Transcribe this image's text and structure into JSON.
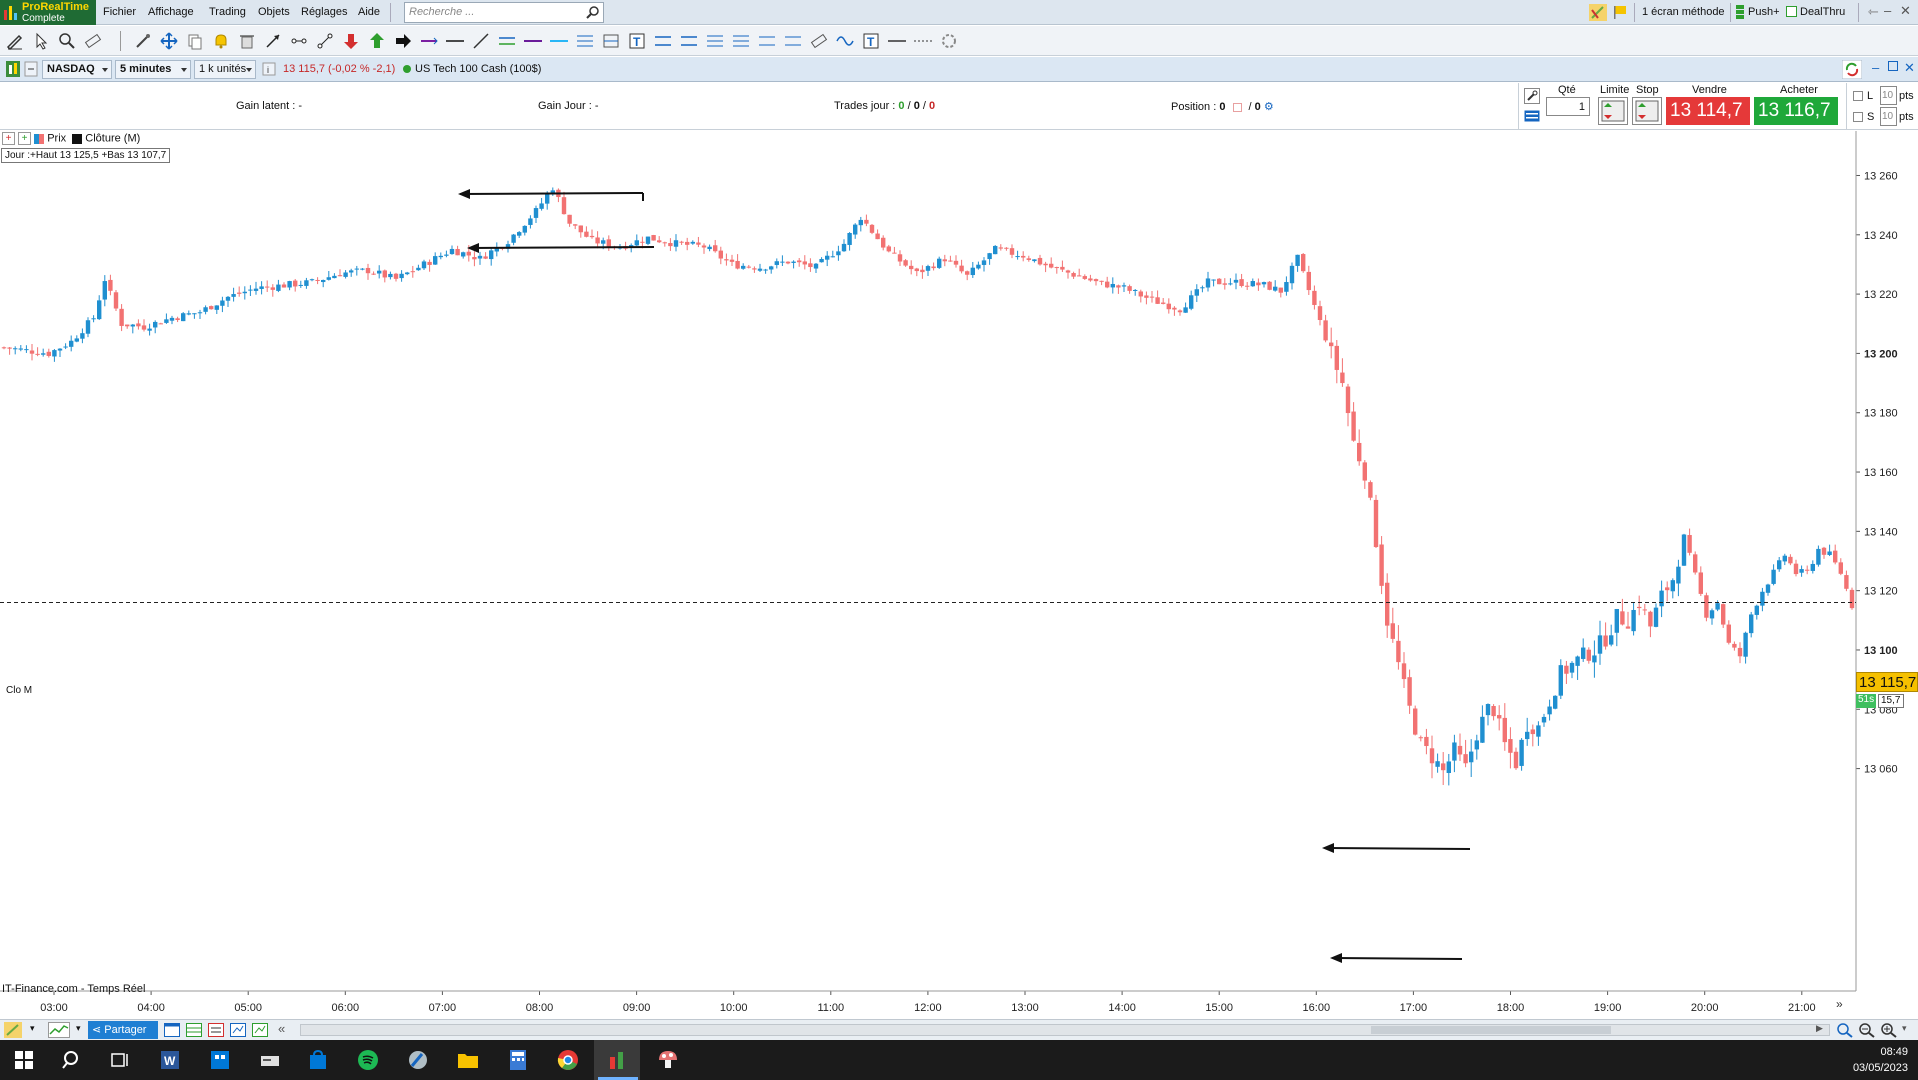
{
  "app": {
    "brand_line1": "ProRealTime",
    "brand_line2": "Complete"
  },
  "menu": {
    "items": [
      "Fichier",
      "Affichage",
      "Trading",
      "Objets",
      "Réglages",
      "Aide"
    ],
    "search_placeholder": "Recherche ...",
    "layout_label": "1 écran méthode",
    "push_label": "Push+",
    "dealthru_label": "DealThru"
  },
  "instrument": {
    "market": "NASDAQ",
    "timeframe": "5 minutes",
    "units": "1 k unités",
    "quote": "13 115,7 (-0,02 % -2,1)",
    "name": "US Tech 100 Cash (100$)"
  },
  "trading": {
    "gain_latent_label": "Gain latent :",
    "gain_latent_value": "-",
    "gain_jour_label": "Gain Jour :",
    "gain_jour_value": "-",
    "trades_jour_label": "Trades jour :",
    "trades_a": "0",
    "trades_b": "0",
    "trades_c": "0",
    "position_label": "Position :",
    "position_value": "0",
    "position_value2": "0",
    "qty_label": "Qté",
    "qty_value": "1",
    "limit_label": "Limite",
    "stop_label": "Stop",
    "sell_label": "Vendre",
    "sell_price": "13 114,7",
    "buy_label": "Acheter",
    "buy_price": "13 116,7",
    "l_label": "L",
    "s_label": "S",
    "l_pts": "10",
    "s_pts": "10",
    "pts_label": "pts"
  },
  "legend": {
    "price_label": "Prix",
    "close_label": "Clôture (M)",
    "day_info": "Jour :+Haut 13 125,5 +Bas 13 107,7",
    "close_line_label": "Clo M",
    "source": "IT-Finance.com - Temps Réel",
    "current_price_tag": "13 115,7",
    "timer_tag": "51s",
    "timer_price": "15,7"
  },
  "bottom": {
    "share_label": "Partager"
  },
  "taskbar": {
    "time": "08:49",
    "date": "03/05/2023"
  },
  "colors": {
    "up": "#1f8fd0",
    "down": "#f27272",
    "current_price_bg": "#f5c000",
    "sell_bg": "#e53939",
    "buy_bg": "#1fa83a"
  },
  "chart_data": {
    "type": "candlestick",
    "ylim": [
      13043,
      13275
    ],
    "yticks": [
      13260,
      13240,
      13220,
      13200,
      13180,
      13160,
      13140,
      13120,
      13100,
      13080,
      13060
    ],
    "ytick_labels": [
      "13 260",
      "13 240",
      "13 220",
      "13 200",
      "13 180",
      "13 160",
      "13 140",
      "13 120",
      "13 100",
      "13 080",
      "13 060"
    ],
    "xticks": [
      "03:00",
      "04:00",
      "05:00",
      "06:00",
      "07:00",
      "08:00",
      "09:00",
      "10:00",
      "11:00",
      "12:00",
      "13:00",
      "14:00",
      "15:00",
      "16:00",
      "17:00",
      "18:00",
      "19:00",
      "20:00",
      "21:00"
    ],
    "close_reference": 13116,
    "anchors": [
      [
        0,
        13202
      ],
      [
        8,
        13200
      ],
      [
        12,
        13204
      ],
      [
        16,
        13212
      ],
      [
        18,
        13225
      ],
      [
        21,
        13210
      ],
      [
        25,
        13209
      ],
      [
        30,
        13212
      ],
      [
        35,
        13214
      ],
      [
        40,
        13219
      ],
      [
        45,
        13222
      ],
      [
        50,
        13223
      ],
      [
        55,
        13224
      ],
      [
        60,
        13227
      ],
      [
        65,
        13228
      ],
      [
        70,
        13225
      ],
      [
        75,
        13230
      ],
      [
        80,
        13235
      ],
      [
        85,
        13232
      ],
      [
        90,
        13238
      ],
      [
        95,
        13248
      ],
      [
        98,
        13256
      ],
      [
        101,
        13244
      ],
      [
        105,
        13238
      ],
      [
        110,
        13236
      ],
      [
        115,
        13239
      ],
      [
        120,
        13237
      ],
      [
        125,
        13236
      ],
      [
        130,
        13230
      ],
      [
        135,
        13229
      ],
      [
        140,
        13231
      ],
      [
        145,
        13229
      ],
      [
        150,
        13237
      ],
      [
        153,
        13246
      ],
      [
        158,
        13234
      ],
      [
        163,
        13227
      ],
      [
        168,
        13232
      ],
      [
        172,
        13226
      ],
      [
        177,
        13235
      ],
      [
        182,
        13233
      ],
      [
        187,
        13229
      ],
      [
        192,
        13226
      ],
      [
        195,
        13224
      ],
      [
        200,
        13222
      ],
      [
        205,
        13218
      ],
      [
        210,
        13215
      ],
      [
        215,
        13224
      ],
      [
        220,
        13224
      ],
      [
        225,
        13223
      ],
      [
        228,
        13221
      ],
      [
        231,
        13232
      ],
      [
        234,
        13216
      ],
      [
        237,
        13200
      ],
      [
        239,
        13190
      ],
      [
        241,
        13170
      ],
      [
        243,
        13160
      ],
      [
        245,
        13137
      ],
      [
        247,
        13110
      ],
      [
        249,
        13095
      ],
      [
        251,
        13080
      ],
      [
        253,
        13068
      ],
      [
        255,
        13064
      ],
      [
        257,
        13059
      ],
      [
        259,
        13066
      ],
      [
        261,
        13060
      ],
      [
        263,
        13072
      ],
      [
        265,
        13080
      ],
      [
        266,
        13080
      ],
      [
        268,
        13068
      ],
      [
        270,
        13062
      ],
      [
        272,
        13075
      ],
      [
        274,
        13074
      ],
      [
        276,
        13083
      ],
      [
        278,
        13092
      ],
      [
        280,
        13095
      ],
      [
        282,
        13098
      ],
      [
        284,
        13100
      ],
      [
        286,
        13104
      ],
      [
        288,
        13111
      ],
      [
        290,
        13110
      ],
      [
        292,
        13116
      ],
      [
        294,
        13108
      ],
      [
        296,
        13118
      ],
      [
        298,
        13124
      ],
      [
        300,
        13138
      ],
      [
        302,
        13125
      ],
      [
        304,
        13112
      ],
      [
        306,
        13116
      ],
      [
        308,
        13102
      ],
      [
        310,
        13098
      ],
      [
        312,
        13112
      ],
      [
        314,
        13120
      ],
      [
        316,
        13126
      ],
      [
        318,
        13132
      ],
      [
        320,
        13126
      ],
      [
        322,
        13126
      ],
      [
        324,
        13134
      ],
      [
        326,
        13132
      ],
      [
        328,
        13126
      ],
      [
        330,
        13115
      ]
    ]
  }
}
